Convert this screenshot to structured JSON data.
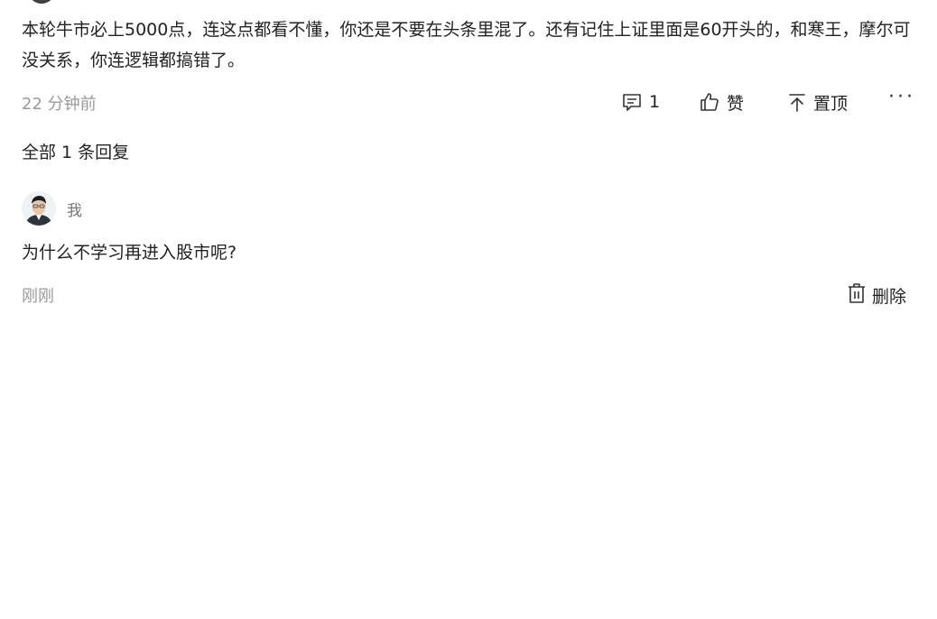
{
  "comment": {
    "text": "本轮牛市必上5000点，连这点都看不懂，你还是不要在头条里混了。还有记住上证里面是60开头的，和寒王，摩尔可没关系，你连逻辑都搞错了。",
    "timestamp": "22 分钟前",
    "actions": {
      "reply_count": "1",
      "like_label": "赞",
      "pin_label": "置顶",
      "more_label": "···"
    }
  },
  "replies": {
    "heading": "全部 1 条回复",
    "items": [
      {
        "author": "我",
        "text": "为什么不学习再进入股市呢?",
        "time": "刚刚",
        "delete_label": "删除"
      }
    ]
  }
}
